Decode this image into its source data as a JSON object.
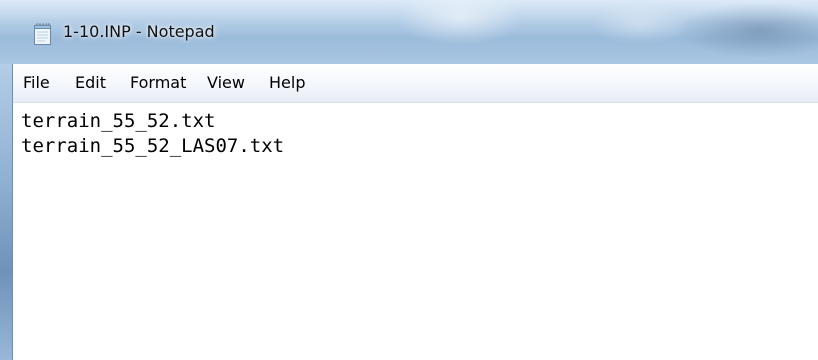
{
  "window": {
    "title": "1-10.INP - Notepad",
    "icon": "notepad-icon"
  },
  "menubar": {
    "items": [
      "File",
      "Edit",
      "Format",
      "View",
      "Help"
    ]
  },
  "editor": {
    "lines": [
      "terrain_55_52.txt",
      "terrain_55_52_LAS07.txt"
    ]
  },
  "colors": {
    "titlebar": "#b3cde6",
    "frame": "#8fb0d2",
    "menubar": "#f4f7fc",
    "editor_bg": "#ffffff",
    "text": "#000000"
  }
}
